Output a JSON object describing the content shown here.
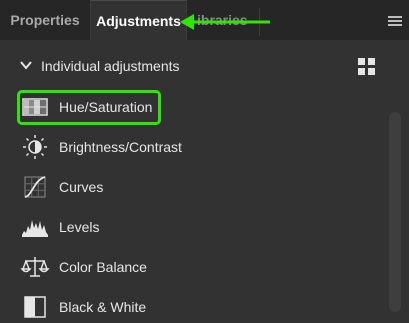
{
  "tabs": [
    {
      "label": "Properties",
      "active": false
    },
    {
      "label": "Adjustments",
      "active": true
    },
    {
      "label": "ibraries",
      "active": false
    }
  ],
  "section": {
    "title": "Individual adjustments",
    "expanded": true
  },
  "items": [
    {
      "label": "Hue/Saturation",
      "icon": "hue-saturation-icon",
      "highlighted": true
    },
    {
      "label": "Brightness/Contrast",
      "icon": "brightness-contrast-icon"
    },
    {
      "label": "Curves",
      "icon": "curves-icon"
    },
    {
      "label": "Levels",
      "icon": "levels-icon"
    },
    {
      "label": "Color Balance",
      "icon": "color-balance-icon"
    },
    {
      "label": "Black & White",
      "icon": "black-white-icon"
    }
  ],
  "colors": {
    "highlight": "#2ee600",
    "annotation_arrow": "#2ee600",
    "panel": "#323232",
    "tabbar": "#262626"
  }
}
